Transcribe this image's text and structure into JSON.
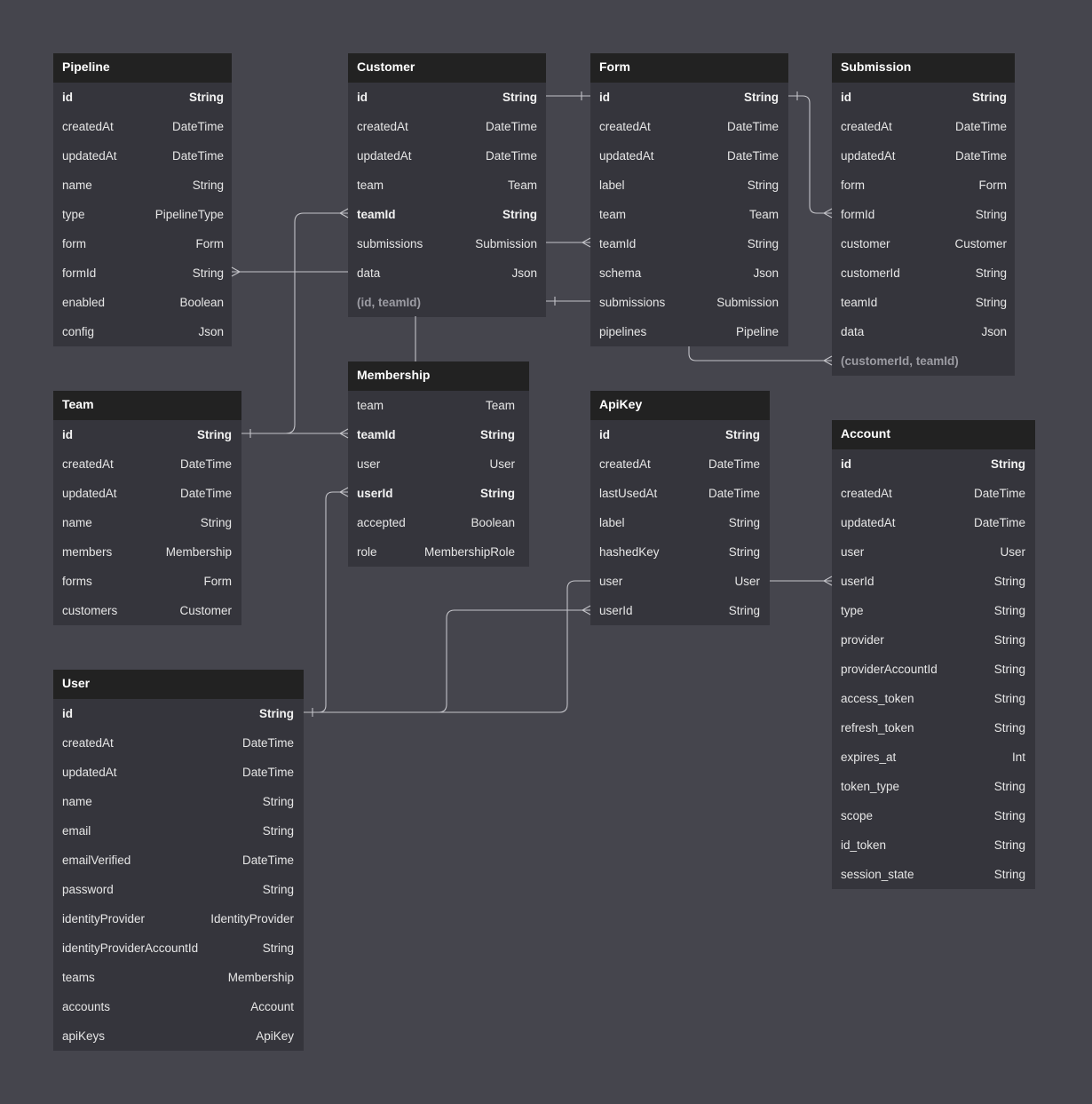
{
  "entities": {
    "pipeline": {
      "title": "Pipeline",
      "fields": [
        {
          "name": "id",
          "type": "String",
          "pk": true
        },
        {
          "name": "createdAt",
          "type": "DateTime"
        },
        {
          "name": "updatedAt",
          "type": "DateTime"
        },
        {
          "name": "name",
          "type": "String"
        },
        {
          "name": "type",
          "type": "PipelineType"
        },
        {
          "name": "form",
          "type": "Form"
        },
        {
          "name": "formId",
          "type": "String"
        },
        {
          "name": "enabled",
          "type": "Boolean"
        },
        {
          "name": "config",
          "type": "Json"
        }
      ]
    },
    "customer": {
      "title": "Customer",
      "fields": [
        {
          "name": "id",
          "type": "String",
          "pk": true
        },
        {
          "name": "createdAt",
          "type": "DateTime"
        },
        {
          "name": "updatedAt",
          "type": "DateTime"
        },
        {
          "name": "team",
          "type": "Team"
        },
        {
          "name": "teamId",
          "type": "String",
          "pk": true
        },
        {
          "name": "submissions",
          "type": "Submission"
        },
        {
          "name": "data",
          "type": "Json"
        },
        {
          "name": "(id, teamId)",
          "type": "",
          "muted": true
        }
      ]
    },
    "form": {
      "title": "Form",
      "fields": [
        {
          "name": "id",
          "type": "String",
          "pk": true
        },
        {
          "name": "createdAt",
          "type": "DateTime"
        },
        {
          "name": "updatedAt",
          "type": "DateTime"
        },
        {
          "name": "label",
          "type": "String"
        },
        {
          "name": "team",
          "type": "Team"
        },
        {
          "name": "teamId",
          "type": "String"
        },
        {
          "name": "schema",
          "type": "Json"
        },
        {
          "name": "submissions",
          "type": "Submission"
        },
        {
          "name": "pipelines",
          "type": "Pipeline"
        }
      ]
    },
    "submission": {
      "title": "Submission",
      "fields": [
        {
          "name": "id",
          "type": "String",
          "pk": true
        },
        {
          "name": "createdAt",
          "type": "DateTime"
        },
        {
          "name": "updatedAt",
          "type": "DateTime"
        },
        {
          "name": "form",
          "type": "Form"
        },
        {
          "name": "formId",
          "type": "String"
        },
        {
          "name": "customer",
          "type": "Customer"
        },
        {
          "name": "customerId",
          "type": "String"
        },
        {
          "name": "teamId",
          "type": "String"
        },
        {
          "name": "data",
          "type": "Json"
        },
        {
          "name": "(customerId, teamId)",
          "type": "",
          "muted": true
        }
      ]
    },
    "team": {
      "title": "Team",
      "fields": [
        {
          "name": "id",
          "type": "String",
          "pk": true
        },
        {
          "name": "createdAt",
          "type": "DateTime"
        },
        {
          "name": "updatedAt",
          "type": "DateTime"
        },
        {
          "name": "name",
          "type": "String"
        },
        {
          "name": "members",
          "type": "Membership"
        },
        {
          "name": "forms",
          "type": "Form"
        },
        {
          "name": "customers",
          "type": "Customer"
        }
      ]
    },
    "membership": {
      "title": "Membership",
      "fields": [
        {
          "name": "team",
          "type": "Team"
        },
        {
          "name": "teamId",
          "type": "String",
          "pk": true
        },
        {
          "name": "user",
          "type": "User"
        },
        {
          "name": "userId",
          "type": "String",
          "pk": true
        },
        {
          "name": "accepted",
          "type": "Boolean"
        },
        {
          "name": "role",
          "type": "MembershipRole"
        }
      ]
    },
    "apikey": {
      "title": "ApiKey",
      "fields": [
        {
          "name": "id",
          "type": "String",
          "pk": true
        },
        {
          "name": "createdAt",
          "type": "DateTime"
        },
        {
          "name": "lastUsedAt",
          "type": "DateTime"
        },
        {
          "name": "label",
          "type": "String"
        },
        {
          "name": "hashedKey",
          "type": "String"
        },
        {
          "name": "user",
          "type": "User"
        },
        {
          "name": "userId",
          "type": "String"
        }
      ]
    },
    "account": {
      "title": "Account",
      "fields": [
        {
          "name": "id",
          "type": "String",
          "pk": true
        },
        {
          "name": "createdAt",
          "type": "DateTime"
        },
        {
          "name": "updatedAt",
          "type": "DateTime"
        },
        {
          "name": "user",
          "type": "User"
        },
        {
          "name": "userId",
          "type": "String"
        },
        {
          "name": "type",
          "type": "String"
        },
        {
          "name": "provider",
          "type": "String"
        },
        {
          "name": "providerAccountId",
          "type": "String"
        },
        {
          "name": "access_token",
          "type": "String"
        },
        {
          "name": "refresh_token",
          "type": "String"
        },
        {
          "name": "expires_at",
          "type": "Int"
        },
        {
          "name": "token_type",
          "type": "String"
        },
        {
          "name": "scope",
          "type": "String"
        },
        {
          "name": "id_token",
          "type": "String"
        },
        {
          "name": "session_state",
          "type": "String"
        }
      ]
    },
    "user": {
      "title": "User",
      "fields": [
        {
          "name": "id",
          "type": "String",
          "pk": true
        },
        {
          "name": "createdAt",
          "type": "DateTime"
        },
        {
          "name": "updatedAt",
          "type": "DateTime"
        },
        {
          "name": "name",
          "type": "String"
        },
        {
          "name": "email",
          "type": "String"
        },
        {
          "name": "emailVerified",
          "type": "DateTime"
        },
        {
          "name": "password",
          "type": "String"
        },
        {
          "name": "identityProvider",
          "type": "IdentityProvider"
        },
        {
          "name": "identityProviderAccountId",
          "type": "String"
        },
        {
          "name": "teams",
          "type": "Membership"
        },
        {
          "name": "accounts",
          "type": "Account"
        },
        {
          "name": "apiKeys",
          "type": "ApiKey"
        }
      ]
    }
  },
  "colors": {
    "background": "#45454d",
    "entity_body": "#35353c",
    "entity_header": "#222222",
    "connector": "#c4c4c9"
  }
}
